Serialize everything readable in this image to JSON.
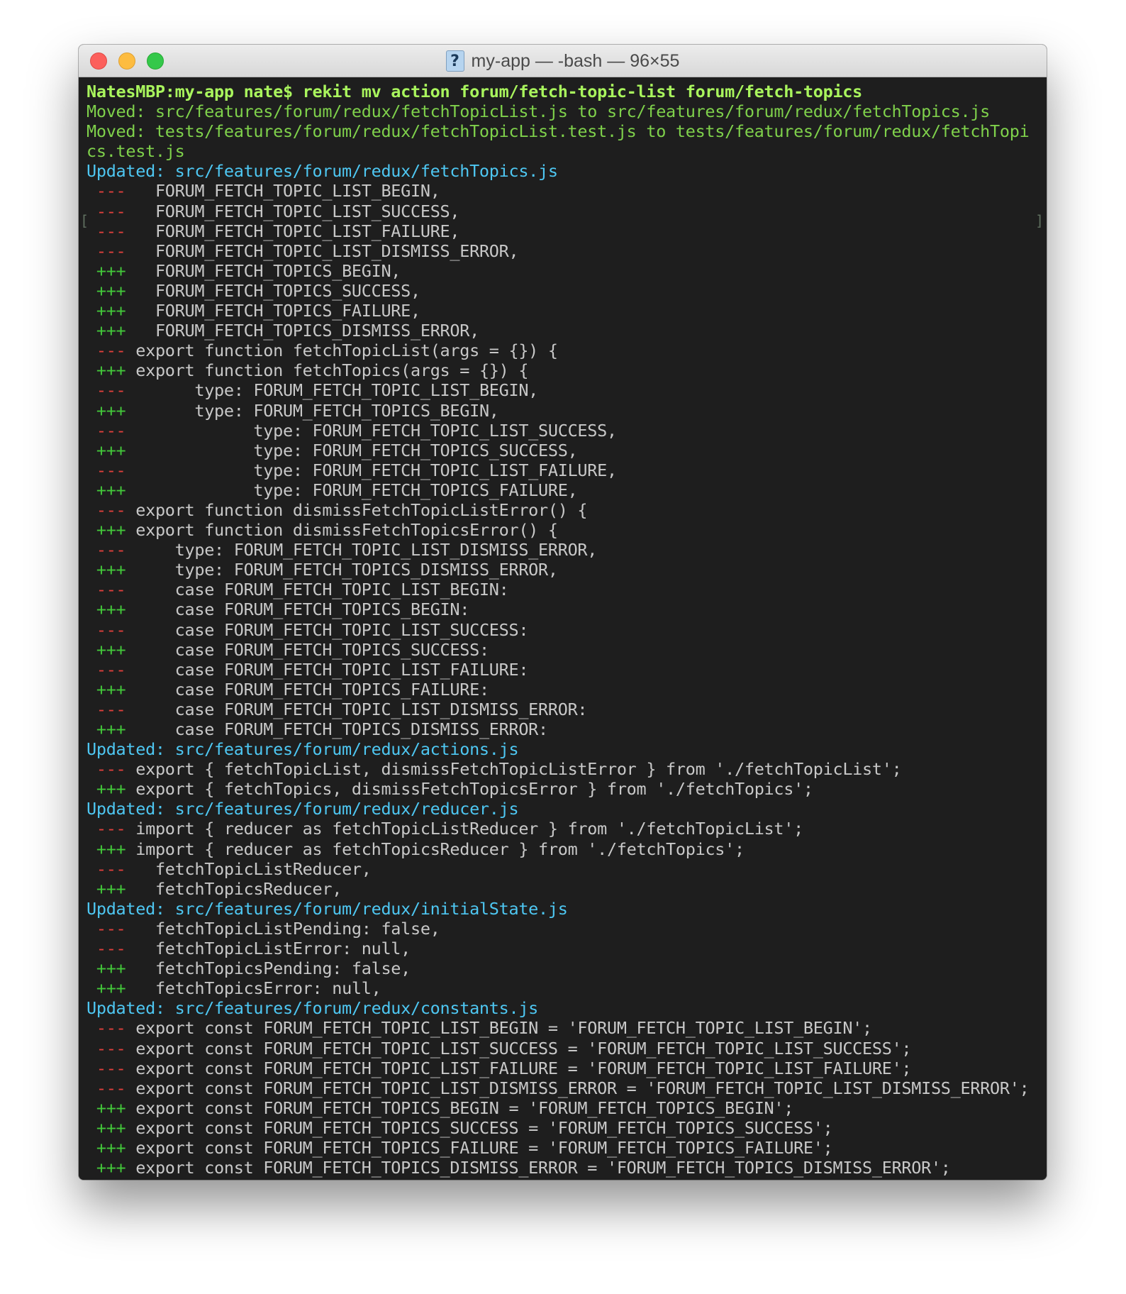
{
  "window": {
    "title": "my-app — -bash — 96×55",
    "icon": "document-icon"
  },
  "terminal": {
    "lines": [
      {
        "kind": "prompt",
        "text": "NatesMBP:my-app nate$ rekit mv action forum/fetch-topic-list forum/fetch-topics"
      },
      {
        "kind": "moved",
        "text": "Moved: src/features/forum/redux/fetchTopicList.js to src/features/forum/redux/fetchTopics.js"
      },
      {
        "kind": "moved",
        "text": "Moved: tests/features/forum/redux/fetchTopicList.test.js to tests/features/forum/redux/fetchTopi"
      },
      {
        "kind": "moved",
        "text": "cs.test.js"
      },
      {
        "kind": "updated",
        "text": "Updated: src/features/forum/redux/fetchTopics.js"
      },
      {
        "kind": "del",
        "marker": " ---",
        "text": "   FORUM_FETCH_TOPIC_LIST_BEGIN,"
      },
      {
        "kind": "del",
        "marker": " ---",
        "text": "   FORUM_FETCH_TOPIC_LIST_SUCCESS,"
      },
      {
        "kind": "del",
        "marker": " ---",
        "text": "   FORUM_FETCH_TOPIC_LIST_FAILURE,"
      },
      {
        "kind": "del",
        "marker": " ---",
        "text": "   FORUM_FETCH_TOPIC_LIST_DISMISS_ERROR,"
      },
      {
        "kind": "add",
        "marker": " +++",
        "text": "   FORUM_FETCH_TOPICS_BEGIN,"
      },
      {
        "kind": "add",
        "marker": " +++",
        "text": "   FORUM_FETCH_TOPICS_SUCCESS,"
      },
      {
        "kind": "add",
        "marker": " +++",
        "text": "   FORUM_FETCH_TOPICS_FAILURE,"
      },
      {
        "kind": "add",
        "marker": " +++",
        "text": "   FORUM_FETCH_TOPICS_DISMISS_ERROR,"
      },
      {
        "kind": "del",
        "marker": " ---",
        "text": " export function fetchTopicList(args = {}) {"
      },
      {
        "kind": "add",
        "marker": " +++",
        "text": " export function fetchTopics(args = {}) {"
      },
      {
        "kind": "del",
        "marker": " ---",
        "text": "       type: FORUM_FETCH_TOPIC_LIST_BEGIN,"
      },
      {
        "kind": "add",
        "marker": " +++",
        "text": "       type: FORUM_FETCH_TOPICS_BEGIN,"
      },
      {
        "kind": "del",
        "marker": " ---",
        "text": "             type: FORUM_FETCH_TOPIC_LIST_SUCCESS,"
      },
      {
        "kind": "add",
        "marker": " +++",
        "text": "             type: FORUM_FETCH_TOPICS_SUCCESS,"
      },
      {
        "kind": "del",
        "marker": " ---",
        "text": "             type: FORUM_FETCH_TOPIC_LIST_FAILURE,"
      },
      {
        "kind": "add",
        "marker": " +++",
        "text": "             type: FORUM_FETCH_TOPICS_FAILURE,"
      },
      {
        "kind": "del",
        "marker": " ---",
        "text": " export function dismissFetchTopicListError() {"
      },
      {
        "kind": "add",
        "marker": " +++",
        "text": " export function dismissFetchTopicsError() {"
      },
      {
        "kind": "del",
        "marker": " ---",
        "text": "     type: FORUM_FETCH_TOPIC_LIST_DISMISS_ERROR,"
      },
      {
        "kind": "add",
        "marker": " +++",
        "text": "     type: FORUM_FETCH_TOPICS_DISMISS_ERROR,"
      },
      {
        "kind": "del",
        "marker": " ---",
        "text": "     case FORUM_FETCH_TOPIC_LIST_BEGIN:"
      },
      {
        "kind": "add",
        "marker": " +++",
        "text": "     case FORUM_FETCH_TOPICS_BEGIN:"
      },
      {
        "kind": "del",
        "marker": " ---",
        "text": "     case FORUM_FETCH_TOPIC_LIST_SUCCESS:"
      },
      {
        "kind": "add",
        "marker": " +++",
        "text": "     case FORUM_FETCH_TOPICS_SUCCESS:"
      },
      {
        "kind": "del",
        "marker": " ---",
        "text": "     case FORUM_FETCH_TOPIC_LIST_FAILURE:"
      },
      {
        "kind": "add",
        "marker": " +++",
        "text": "     case FORUM_FETCH_TOPICS_FAILURE:"
      },
      {
        "kind": "del",
        "marker": " ---",
        "text": "     case FORUM_FETCH_TOPIC_LIST_DISMISS_ERROR:"
      },
      {
        "kind": "add",
        "marker": " +++",
        "text": "     case FORUM_FETCH_TOPICS_DISMISS_ERROR:"
      },
      {
        "kind": "updated",
        "text": "Updated: src/features/forum/redux/actions.js"
      },
      {
        "kind": "del",
        "marker": " ---",
        "text": " export { fetchTopicList, dismissFetchTopicListError } from './fetchTopicList';"
      },
      {
        "kind": "add",
        "marker": " +++",
        "text": " export { fetchTopics, dismissFetchTopicsError } from './fetchTopics';"
      },
      {
        "kind": "updated",
        "text": "Updated: src/features/forum/redux/reducer.js"
      },
      {
        "kind": "del",
        "marker": " ---",
        "text": " import { reducer as fetchTopicListReducer } from './fetchTopicList';"
      },
      {
        "kind": "add",
        "marker": " +++",
        "text": " import { reducer as fetchTopicsReducer } from './fetchTopics';"
      },
      {
        "kind": "del",
        "marker": " ---",
        "text": "   fetchTopicListReducer,"
      },
      {
        "kind": "add",
        "marker": " +++",
        "text": "   fetchTopicsReducer,"
      },
      {
        "kind": "updated",
        "text": "Updated: src/features/forum/redux/initialState.js"
      },
      {
        "kind": "del",
        "marker": " ---",
        "text": "   fetchTopicListPending: false,"
      },
      {
        "kind": "del",
        "marker": " ---",
        "text": "   fetchTopicListError: null,"
      },
      {
        "kind": "add",
        "marker": " +++",
        "text": "   fetchTopicsPending: false,"
      },
      {
        "kind": "add",
        "marker": " +++",
        "text": "   fetchTopicsError: null,"
      },
      {
        "kind": "updated",
        "text": "Updated: src/features/forum/redux/constants.js"
      },
      {
        "kind": "del",
        "marker": " ---",
        "text": " export const FORUM_FETCH_TOPIC_LIST_BEGIN = 'FORUM_FETCH_TOPIC_LIST_BEGIN';"
      },
      {
        "kind": "del",
        "marker": " ---",
        "text": " export const FORUM_FETCH_TOPIC_LIST_SUCCESS = 'FORUM_FETCH_TOPIC_LIST_SUCCESS';"
      },
      {
        "kind": "del",
        "marker": " ---",
        "text": " export const FORUM_FETCH_TOPIC_LIST_FAILURE = 'FORUM_FETCH_TOPIC_LIST_FAILURE';"
      },
      {
        "kind": "del",
        "marker": " ---",
        "text": " export const FORUM_FETCH_TOPIC_LIST_DISMISS_ERROR = 'FORUM_FETCH_TOPIC_LIST_DISMISS_ERROR';"
      },
      {
        "kind": "add",
        "marker": " +++",
        "text": " export const FORUM_FETCH_TOPICS_BEGIN = 'FORUM_FETCH_TOPICS_BEGIN';"
      },
      {
        "kind": "add",
        "marker": " +++",
        "text": " export const FORUM_FETCH_TOPICS_SUCCESS = 'FORUM_FETCH_TOPICS_SUCCESS';"
      },
      {
        "kind": "add",
        "marker": " +++",
        "text": " export const FORUM_FETCH_TOPICS_FAILURE = 'FORUM_FETCH_TOPICS_FAILURE';"
      },
      {
        "kind": "add",
        "marker": " +++",
        "text": " export const FORUM_FETCH_TOPICS_DISMISS_ERROR = 'FORUM_FETCH_TOPICS_DISMISS_ERROR';"
      }
    ]
  },
  "colors": {
    "background": "#1e1e1e",
    "prompt": "#a9f55d",
    "moved": "#7fd14b",
    "updated": "#4ec7f2",
    "deleted_marker": "#e2403c",
    "added_marker": "#43c73a",
    "code_text": "#c8c8c8"
  }
}
